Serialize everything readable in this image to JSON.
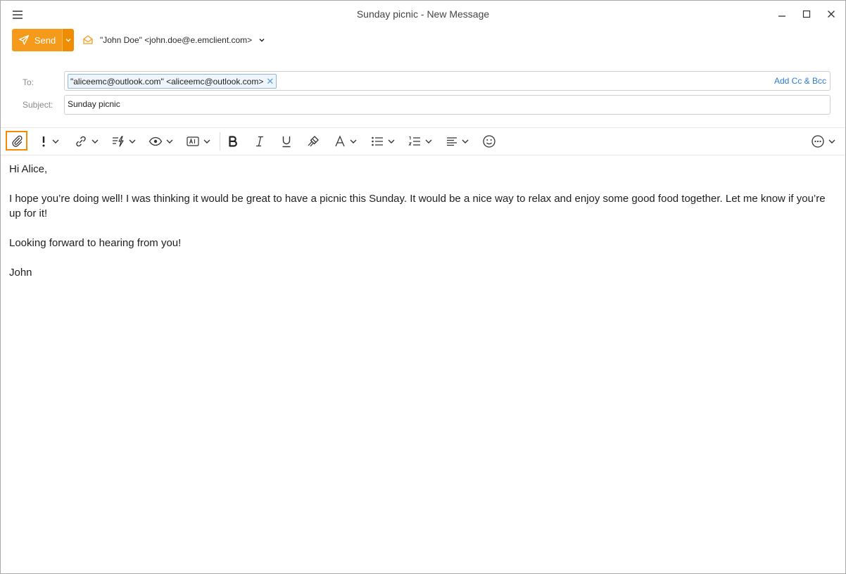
{
  "window": {
    "title": "Sunday picnic - New Message"
  },
  "compose": {
    "send_label": "Send",
    "from_value": "\"John Doe\" <john.doe@e.emclient.com>"
  },
  "header": {
    "to_label": "To:",
    "to_recipient": "\"aliceemc@outlook.com\" <aliceemc@outlook.com>",
    "add_cc_bcc": "Add Cc & Bcc",
    "subject_label": "Subject:",
    "subject_value": "Sunday picnic"
  },
  "toolbar": {
    "icons": [
      "paperclip-icon",
      "priority-icon",
      "link-icon",
      "quick-text-icon",
      "eye-icon",
      "translate-icon",
      "bold-icon",
      "italic-icon",
      "underline-icon",
      "format-painter-icon",
      "font-icon",
      "bulleted-list-icon",
      "numbered-list-icon",
      "align-icon",
      "emoji-icon",
      "more-icon"
    ]
  },
  "message": {
    "greeting": "Hi Alice,",
    "paragraph": "I hope you’re doing well! I was thinking it would be great to have a picnic this Sunday. It would be a nice way to relax and enjoy some good food together. Let me know if you’re up for it!",
    "closing": "Looking forward to hearing from you!",
    "signature": "John"
  },
  "colors": {
    "accent": "#f59a1b",
    "accent_dark": "#f08c00",
    "link": "#2b7bd6",
    "chip_border": "#8fb8dc"
  }
}
